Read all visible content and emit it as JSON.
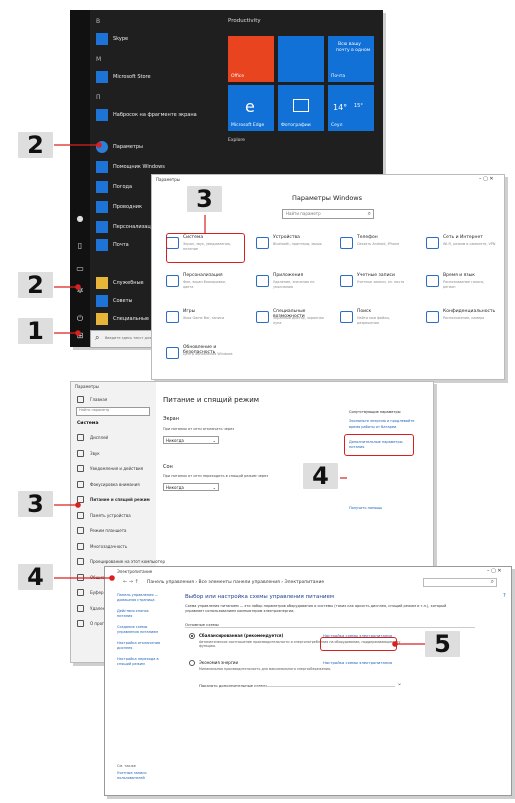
{
  "start_menu": {
    "letters": [
      "B",
      "M",
      "П"
    ],
    "apps": [
      {
        "label": "Skype",
        "icon": "skype-icon"
      },
      {
        "label": "Microsoft Store",
        "icon": "store-icon"
      },
      {
        "label": "Набросок на фрагменте экрана",
        "icon": "snip-icon"
      },
      {
        "label": "Параметры",
        "icon": "gear-icon"
      },
      {
        "label": "Помощник Windows",
        "icon": "folder-icon"
      },
      {
        "label": "Погода",
        "icon": "weather-icon"
      },
      {
        "label": "Проводник",
        "icon": "explorer-icon"
      },
      {
        "label": "Персонализация",
        "icon": "paint-icon"
      },
      {
        "label": "Почта",
        "icon": "mail-icon"
      },
      {
        "label": "Служебные",
        "icon": "folder-icon"
      },
      {
        "label": "Советы",
        "icon": "tips-icon"
      },
      {
        "label": "Специальные",
        "icon": "folder-icon"
      }
    ],
    "group_productivity": "Productivity",
    "group_explore": "Explore",
    "tiles": {
      "office": "Office",
      "mail_top": "Всю вашу",
      "mail_mid": "почту в одном",
      "mail_bottom": "Почта",
      "edge": "Microsoft Edge",
      "photos": "Фотографии",
      "weather_temp": "14°",
      "weather_hi": "15°",
      "weather_city": "Сеул"
    },
    "search_placeholder": "Введите здесь текст для поиска"
  },
  "settings": {
    "title_bar": "Параметры",
    "heading": "Параметры Windows",
    "search_placeholder": "Найти параметр",
    "items": [
      {
        "title": "Система",
        "desc": "Экран, звук, уведомления, питание"
      },
      {
        "title": "Устройства",
        "desc": "Bluetooth, принтеры, мышь"
      },
      {
        "title": "Телефон",
        "desc": "Связать Android, iPhone"
      },
      {
        "title": "Сеть и Интернет",
        "desc": "Wi-Fi, режим в самолете, VPN"
      },
      {
        "title": "Персонализация",
        "desc": "Фон, экран блокировки, цвета"
      },
      {
        "title": "Приложения",
        "desc": "Удаление, значения по умолчанию"
      },
      {
        "title": "Учетные записи",
        "desc": "Учетные записи, эл. почта"
      },
      {
        "title": "Время и язык",
        "desc": "Распознавание голоса, регион"
      },
      {
        "title": "Игры",
        "desc": "Xbox Game Bar, записи"
      },
      {
        "title": "Специальные возможности",
        "desc": "Экранный диктор, экранная лупа"
      },
      {
        "title": "Поиск",
        "desc": "Найти мои файлы, разрешения"
      },
      {
        "title": "Конфиденциальность",
        "desc": "Расположение, камера"
      },
      {
        "title": "Обновление и безопасность",
        "desc": "Центр обновления Windows"
      }
    ]
  },
  "power": {
    "title_bar": "Параметры",
    "home": "Главная",
    "search_placeholder": "Найти параметр",
    "section": "Система",
    "nav": [
      "Дисплей",
      "Звук",
      "Уведомления и действия",
      "Фокусировка внимания",
      "Питание и спящий режим",
      "Память устройства",
      "Режим планшета",
      "Многозадачность",
      "Проецирование на этот компьютер",
      "Общие возможности",
      "Буфер обмена",
      "Удаленный рабочий стол",
      "О программе"
    ],
    "heading": "Питание и спящий режим",
    "screen_label": "Экран",
    "screen_text": "При питании от сети отключать через",
    "screen_value": "Никогда",
    "sleep_label": "Сон",
    "sleep_text": "При питании от сети переходить в спящий режим через",
    "sleep_value": "Никогда",
    "related_heading": "Сопутствующие параметры",
    "related_link1": "Экономьте энергию и продлевайте",
    "related_link2": "время работы от батареи",
    "related_link": "Дополнительные параметры питания",
    "help_link": "Получить помощь"
  },
  "control_panel": {
    "title_bar": "Электропитание",
    "breadcrumb": "Панель управления › Все элементы панели управления › Электропитание",
    "side_links": [
      "Панель управления — домашняя страница",
      "Действия кнопок питания",
      "Создание схемы управления питанием",
      "Настройка отключения дисплея",
      "Настройка перехода в спящий режим"
    ],
    "see_also": "См. также",
    "side_bottom": "Учетные записи пользователей",
    "heading": "Выбор или настройка схемы управления питанием",
    "intro": "Схема управления питанием — это набор параметров оборудования и системы (таких как яркость дисплея, спящий режим и т.п.), который управляет использованием компьютером электроэнергии.",
    "plans_label": "Основные схемы",
    "plan1": "Сбалансированная (рекомендуется)",
    "plan1_desc": "Автоматическое соотношение производительности и энергопотребления на оборудовании, поддерживающем эту функцию.",
    "plan1_link": "Настройка схемы электропитания",
    "plan2": "Экономия энергии",
    "plan2_desc": "Минимальная производительность для максимального энергосбережения.",
    "plan2_link": "Настройка схемы электропитания",
    "more_plans": "Показать дополнительные схемы"
  },
  "callouts": [
    "2",
    "2",
    "1",
    "3",
    "3",
    "4",
    "4",
    "5"
  ],
  "colors": {
    "accent": "#1171d6",
    "highlight": "#d92020",
    "badge": "#dedede"
  }
}
